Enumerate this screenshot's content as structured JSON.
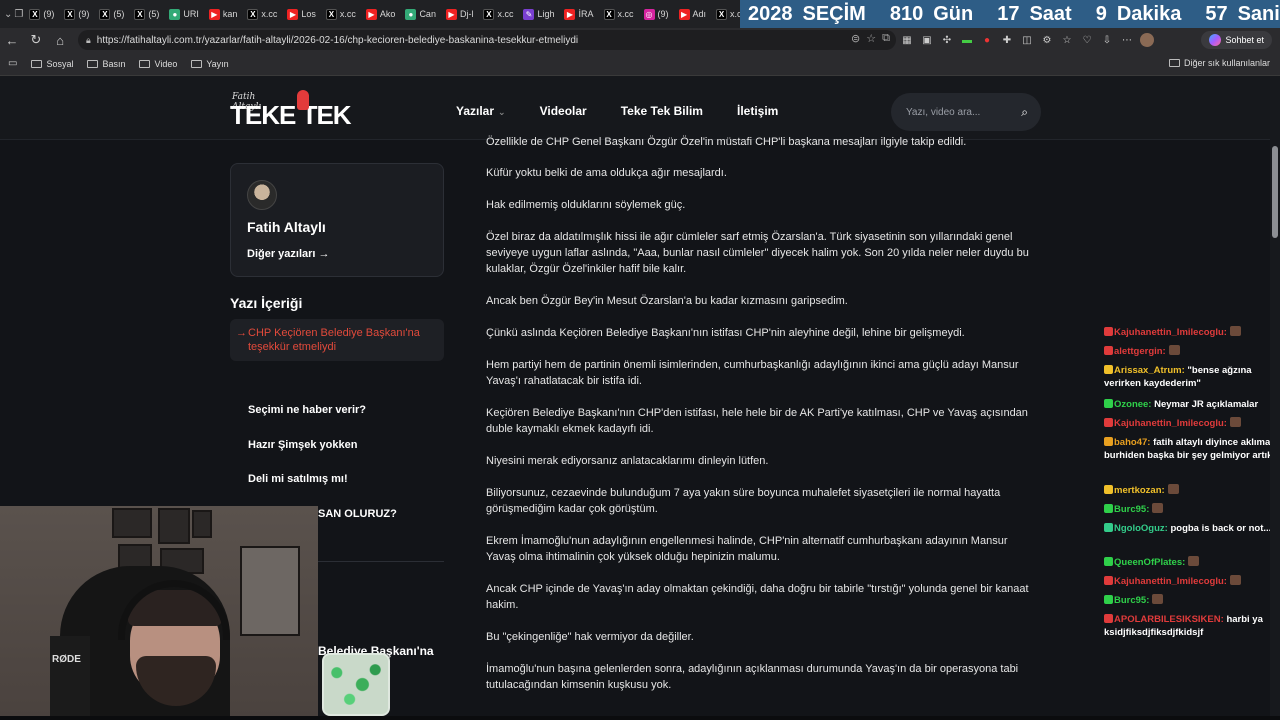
{
  "browser": {
    "tabs": [
      {
        "icon": "x-icon",
        "label": "(9)"
      },
      {
        "icon": "x-icon",
        "label": "(9)"
      },
      {
        "icon": "x-icon",
        "label": "(5)"
      },
      {
        "icon": "x-icon",
        "label": "(5)"
      },
      {
        "icon": "generic-icon",
        "label": "URI"
      },
      {
        "icon": "youtube-icon",
        "label": "kan"
      },
      {
        "icon": "x-icon",
        "label": "x.cc"
      },
      {
        "icon": "youtube-icon",
        "label": "Los"
      },
      {
        "icon": "x-icon",
        "label": "x.cc"
      },
      {
        "icon": "youtube-icon",
        "label": "Ako"
      },
      {
        "icon": "generic-icon",
        "label": "Can"
      },
      {
        "icon": "youtube-icon",
        "label": "Dj-l"
      },
      {
        "icon": "x-icon",
        "label": "x.cc"
      },
      {
        "icon": "pen-icon",
        "label": "Ligh"
      },
      {
        "icon": "youtube-icon",
        "label": "İRA"
      },
      {
        "icon": "x-icon",
        "label": "x.cc"
      },
      {
        "icon": "instagram-icon",
        "label": "(9)"
      },
      {
        "icon": "youtube-icon",
        "label": "Adı"
      },
      {
        "icon": "x-icon",
        "label": "x.cc"
      },
      {
        "icon": "x-icon",
        "label": ""
      }
    ],
    "countdown": {
      "year": "2028",
      "year_label": "SEÇİM",
      "days": "810",
      "days_label": "Gün",
      "hours": "17",
      "hours_label": "Saat",
      "minutes": "9",
      "minutes_label": "Dakika",
      "seconds": "57",
      "seconds_label": "Saniye"
    },
    "url": "https://fatihaltayli.com.tr/yazarlar/fatih-altayli/2026-02-16/chp-kecioren-belediye-baskanina-tesekkur-etmeliydi",
    "chat_button_label": "Sohbet et",
    "bookmarks": [
      "Sosyal",
      "Basın",
      "Video",
      "Yayın"
    ],
    "bookmarks_right": "Diğer sık kullanılanlar"
  },
  "site": {
    "logo_script": "Fatih Altaylı",
    "logo_text": "TEKE TEK",
    "nav": [
      "Yazılar",
      "Videolar",
      "Teke Tek Bilim",
      "İletişim"
    ],
    "search_placeholder": "Yazı, video ara...",
    "author": {
      "name": "Fatih Altaylı",
      "more_label": "Diğer yazıları"
    },
    "toc_title": "Yazı İçeriği",
    "toc_item": "CHP Keçiören Belediye Başkanı'na teşekkür etmeliydi",
    "other_links": [
      "Seçimi ne haber verir?",
      "Hazır Şimşek yokken",
      "Deli mi satılmış mı!",
      "SAN OLURUZ?"
    ],
    "partial_title": "Belediye Başkanı'na"
  },
  "article": [
    "Özellikle de CHP Genel Başkanı Özgür Özel'in müstafi CHP'li başkana mesajları ilgiyle takip edildi.",
    "Küfür yoktu belki de ama oldukça ağır mesajlardı.",
    "Hak edilmemiş olduklarını söylemek güç.",
    "Özel biraz da aldatılmışlık hissi ile ağır cümleler sarf etmiş Özarslan'a. Türk siyasetinin son yıllarındaki genel seviyeye uygun laflar aslında, \"Aaa, bunlar nasıl cümleler\" diyecek halim yok. Son 20 yılda neler neler duydu bu kulaklar, Özgür Özel'inkiler hafif bile kalır.",
    "Ancak ben Özgür Bey'in Mesut Özarslan'a bu kadar kızmasını garipsedim.",
    "Çünkü aslında Keçiören Belediye Başkanı'nın istifası CHP'nin aleyhine değil, lehine bir gelişmeydi.",
    "Hem partiyi hem de partinin önemli isimlerinden, cumhurbaşkanlığı adaylığının ikinci ama güçlü adayı Mansur Yavaş'ı rahatlatacak bir istifa idi.",
    "Keçiören Belediye Başkanı'nın CHP'den istifası, hele hele bir de AK Parti'ye katılması, CHP ve Yavaş açısından duble kaymaklı ekmek kadayıfı idi.",
    "Niyesini merak ediyorsanız anlatacaklarımı dinleyin lütfen.",
    "Biliyorsunuz, cezaevinde bulunduğum 7 aya yakın süre boyunca muhalefet siyasetçileri ile normal hayatta görüşmediğim kadar çok görüştüm.",
    "Ekrem İmamoğlu'nun adaylığının engellenmesi halinde, CHP'nin alternatif cumhurbaşkanı adayının Mansur Yavaş olma ihtimalinin çok yüksek olduğu hepinizin malumu.",
    "Ancak CHP içinde de Yavaş'ın aday olmaktan çekindiği, daha doğru bir tabirle \"tırstığı\" yolunda genel bir kanaat hakim.",
    "Bu \"çekingenliğe\" hak vermiyor da değiller.",
    "İmamoğlu'nun başına gelenlerden sonra, adaylığının açıklanması durumunda Yavaş'ın da bir operasyona tabi tutulacağından kimsenin kuşkusu yok."
  ],
  "chat": [
    {
      "user": "Kajuhanettin_Imilecoglu:",
      "text": "",
      "color": "#e03b3b"
    },
    {
      "user": "alettgergin:",
      "text": "",
      "color": "#e03b3b"
    },
    {
      "user": "Arissax_Atrum:",
      "text": "\"bense ağzına verirken kaydederim\"",
      "color": "#f0c02a"
    },
    {
      "user": "Ozonee:",
      "text": "Neymar JR açıklamalar",
      "color": "#2fd04a"
    },
    {
      "user": "Kajuhanettin_Imilecoglu:",
      "text": "",
      "color": "#e03b3b"
    },
    {
      "user": "baho47:",
      "text": "fatih altaylı diyince aklıma burhiden başka bir şey gelmiyor artık",
      "color": "#e8a020"
    },
    {
      "user": "mertkozan:",
      "text": "",
      "color": "#f0c02a"
    },
    {
      "user": "Burc95:",
      "text": "",
      "color": "#2fd04a"
    },
    {
      "user": "NgoloOguz:",
      "text": "pogba is back or not...",
      "color": "#33cc8a"
    },
    {
      "user": "QueenOfPlates:",
      "text": "",
      "color": "#2fd04a"
    },
    {
      "user": "Kajuhanettin_Imilecoglu:",
      "text": "",
      "color": "#e03b3b"
    },
    {
      "user": "Burc95:",
      "text": "",
      "color": "#2fd04a"
    },
    {
      "user": "APOLARBILESIKSIKEN:",
      "text": "harbi ya ksidjfiksdjfiksdjfkidsjf",
      "color": "#e03b3b"
    }
  ],
  "webcam": {
    "mic_brand": "RØDE"
  },
  "colors": {
    "accent_red": "#e24a3b",
    "countdown_bg": "#2e5d86"
  }
}
